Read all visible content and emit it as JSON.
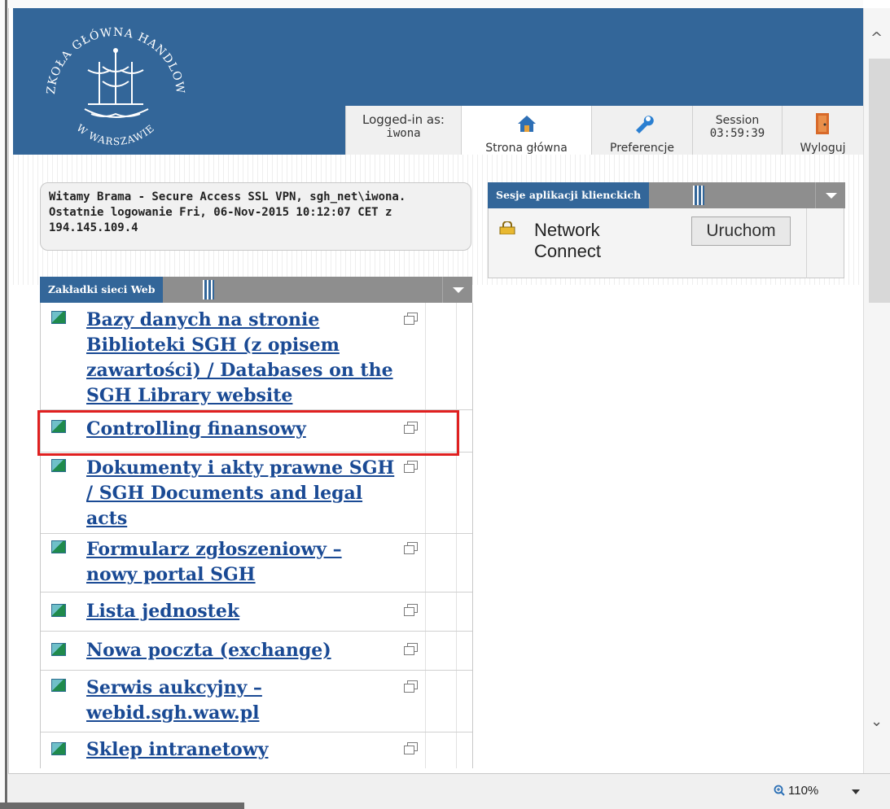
{
  "header": {
    "logo_text_top": "SZKOŁA GŁÓWNA HANDLOWA",
    "logo_text_bottom": "W WARSZAWIE",
    "logged_in_label": "Logged-in as:",
    "logged_in_user": "iwona",
    "home_label": "Strona główna",
    "preferences_label": "Preferencje",
    "session_label": "Session",
    "session_time": "03:59:39",
    "logout_label": "Wyloguj"
  },
  "welcome": {
    "text": "Witamy Brama - Secure Access SSL VPN, sgh_net\\iwona. Ostatnie logowanie Fri, 06-Nov-2015 10:12:07 CET  z 194.145.109.4"
  },
  "bookmarks": {
    "title": "Zakładki sieci Web",
    "items": [
      {
        "label": "Bazy danych na stronie Biblioteki SGH (z opisem zawartości) / Databases on the SGH Library website"
      },
      {
        "label": "Controlling finansowy"
      },
      {
        "label": "Dokumenty i akty prawne SGH / SGH Documents and legal acts"
      },
      {
        "label": "Formularz zgłoszeniowy – nowy portal SGH"
      },
      {
        "label": "Lista jednostek"
      },
      {
        "label": "Nowa poczta (exchange)"
      },
      {
        "label": "Serwis aukcyjny – webid.sgh.waw.pl"
      },
      {
        "label": "Sklep intranetowy"
      }
    ]
  },
  "client_apps": {
    "title": "Sesje aplikacji klienckich",
    "app_name": "Network Connect",
    "launch_label": "Uruchom"
  },
  "statusbar": {
    "zoom": "110%"
  },
  "colors": {
    "header_blue": "#336699",
    "link_blue": "#1a4a94",
    "highlight_red": "#e02020"
  }
}
